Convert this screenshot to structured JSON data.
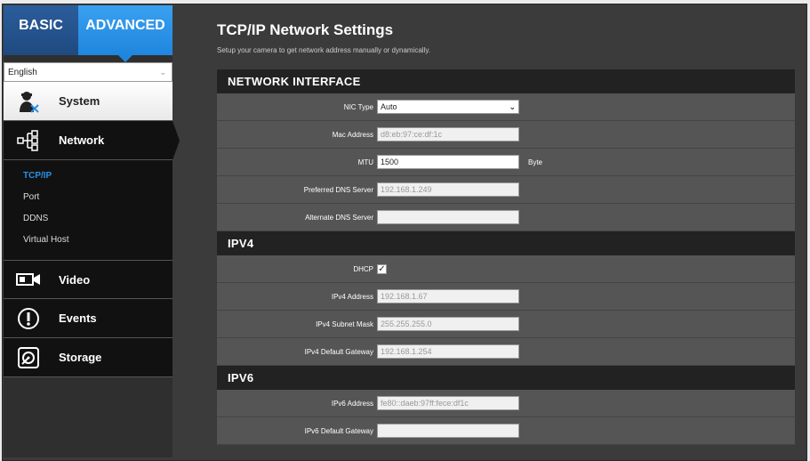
{
  "sidebar": {
    "tabs": {
      "basic": "BASIC",
      "advanced": "ADVANCED"
    },
    "language": "English",
    "menu": [
      {
        "label": "System"
      },
      {
        "label": "Network"
      },
      {
        "label": "Video"
      },
      {
        "label": "Events"
      },
      {
        "label": "Storage"
      }
    ],
    "network_sub": [
      "TCP/IP",
      "Port",
      "DDNS",
      "Virtual Host"
    ]
  },
  "main": {
    "title": "TCP/IP Network Settings",
    "subtitle": "Setup your camera to get network address manually or dynamically."
  },
  "network_interface": {
    "header": "NETWORK INTERFACE",
    "nic_type_label": "NIC Type",
    "nic_type_value": "Auto",
    "mac_label": "Mac Address",
    "mac_value": "d8:eb:97:ce:df:1c",
    "mtu_label": "MTU",
    "mtu_value": "1500",
    "mtu_unit": "Byte",
    "pref_dns_label": "Preferred DNS Server",
    "pref_dns_value": "192.168.1.249",
    "alt_dns_label": "Alternate DNS Server",
    "alt_dns_value": ""
  },
  "ipv4": {
    "header": "IPV4",
    "dhcp_label": "DHCP",
    "dhcp_checked": true,
    "address_label": "IPv4 Address",
    "address_value": "192.168.1.67",
    "mask_label": "IPv4 Subnet Mask",
    "mask_value": "255.255.255.0",
    "gateway_label": "IPv4 Default Gateway",
    "gateway_value": "192.168.1.254"
  },
  "ipv6": {
    "header": "IPV6",
    "address_label": "IPv6 Address",
    "address_value": "fe80::daeb:97ff:fece:df1c",
    "gateway_label": "IPv6 Default Gateway",
    "gateway_value": ""
  }
}
